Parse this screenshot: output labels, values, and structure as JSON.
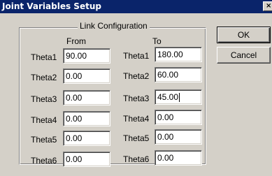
{
  "window": {
    "title": "Joint Variables Setup",
    "close_glyph": "×",
    "close_icon": "close-icon"
  },
  "group": {
    "legend": "Link Configuration",
    "from_header": "From",
    "to_header": "To"
  },
  "from": [
    {
      "label": "Theta1",
      "value": "90.00"
    },
    {
      "label": "Theta2",
      "value": "0.00"
    },
    {
      "label": "Theta3",
      "value": "0.00"
    },
    {
      "label": "Theta4",
      "value": "0.00"
    },
    {
      "label": "Theta5",
      "value": "0.00"
    },
    {
      "label": "Theta6",
      "value": "0.00"
    }
  ],
  "to": [
    {
      "label": "Theta1",
      "value": "180.00"
    },
    {
      "label": "Theta2",
      "value": "60.00"
    },
    {
      "label": "Theta3",
      "value": "45.00"
    },
    {
      "label": "Theta4",
      "value": "0.00"
    },
    {
      "label": "Theta5",
      "value": "0.00"
    },
    {
      "label": "Theta6",
      "value": "0.00"
    }
  ],
  "buttons": {
    "ok": "OK",
    "cancel": "Cancel"
  }
}
